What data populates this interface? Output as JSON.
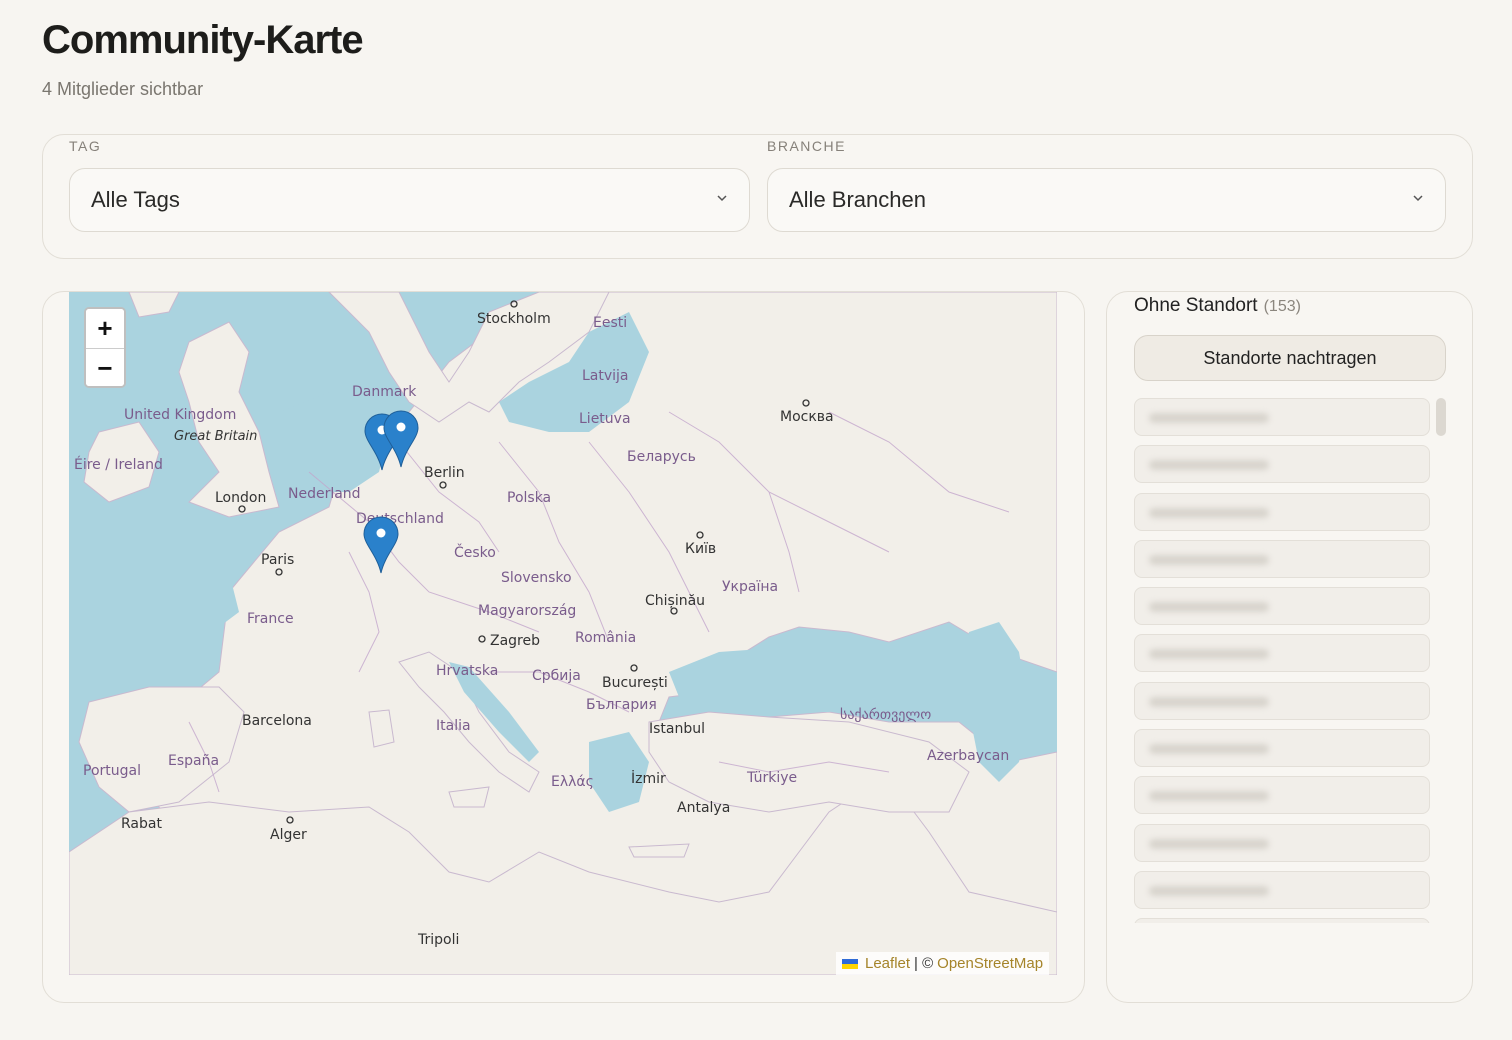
{
  "page": {
    "title": "Community-Karte",
    "subtitle": "4 Mitglieder sichtbar"
  },
  "filters": {
    "tag_label": "TAG",
    "tag_value": "Alle Tags",
    "branche_label": "BRANCHE",
    "branche_value": "Alle Branchen"
  },
  "map": {
    "zoom_in": "+",
    "zoom_out": "−",
    "attribution_leaflet": "Leaflet",
    "attribution_sep": "| ©",
    "attribution_osm": "OpenStreetMap",
    "country_labels": [
      "Danmark",
      "United Kingdom",
      "Éire / Ireland",
      "Nederland",
      "Deutschland",
      "Polska",
      "Česko",
      "Slovensko",
      "Magyarország",
      "France",
      "España",
      "Portugal",
      "Lietuva",
      "Latvija",
      "Eesti",
      "Беларусь",
      "Україна",
      "România",
      "Србија",
      "Hrvatska",
      "България",
      "Ελλάς",
      "Türkiye",
      "Italia",
      "Azerbaycan",
      "საქართველო"
    ],
    "city_labels": [
      "Stockholm",
      "Москва",
      "Berlin",
      "London",
      "Paris",
      "Київ",
      "Chișinău",
      "Zagreb",
      "București",
      "Istanbul",
      "Barcelona",
      "İzmir",
      "Antalya",
      "Rabat",
      "Alger",
      "Tripoli",
      "Great Britain"
    ],
    "markers": 3
  },
  "sidebar": {
    "title": "Ohne Standort",
    "count": "(153)",
    "button_label": "Standorte nachtragen",
    "items": 11
  }
}
